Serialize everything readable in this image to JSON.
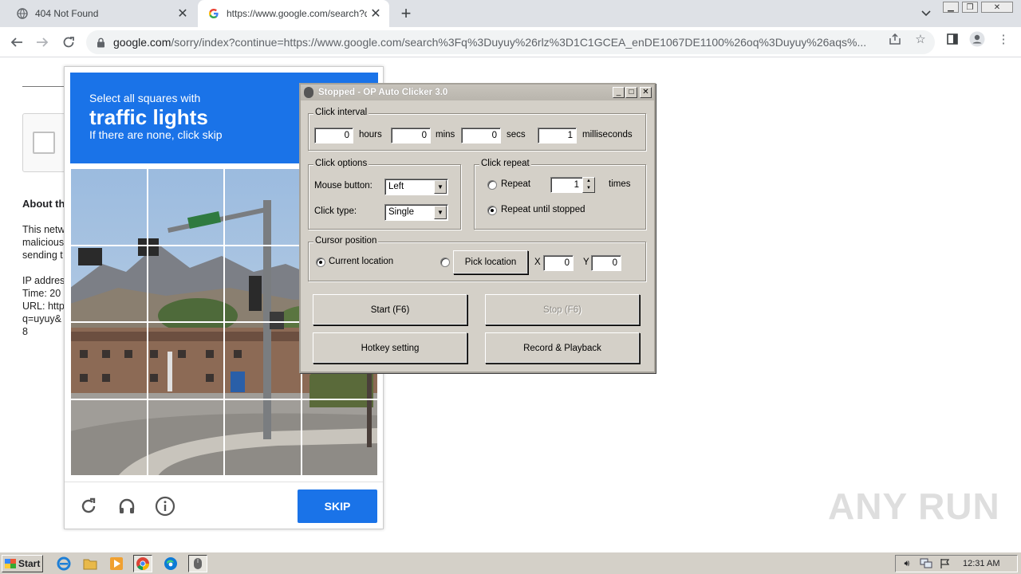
{
  "browser": {
    "tabs": [
      {
        "title": "404 Not Found",
        "favicon": "globe-icon"
      },
      {
        "title": "https://www.google.com/search?q=",
        "favicon": "google-g-icon"
      }
    ],
    "new_tab": "+",
    "url_host": "google.com",
    "url_rest": "/sorry/index?continue=https://www.google.com/search%3Fq%3Duyuy%26rlz%3D1C1GCEA_enDE1067DE1100%26oq%3Duyuy%26aqs%..."
  },
  "page": {
    "about_title": "About th",
    "about_text": "This netw\nmalicious\nsending t\n\nIP addres\nTime: 20\nURL: http\nq=uyuy&\n8"
  },
  "captcha": {
    "instruction": "Select all squares with",
    "target": "traffic lights",
    "hint": "If there are none, click skip",
    "skip_label": "SKIP",
    "colors": {
      "accent": "#1a73e8"
    }
  },
  "clicker": {
    "title": "Stopped - OP Auto Clicker 3.0",
    "interval": {
      "label": "Click interval",
      "hours": "0",
      "hours_label": "hours",
      "mins": "0",
      "mins_label": "mins",
      "secs": "0",
      "secs_label": "secs",
      "ms": "1",
      "ms_label": "milliseconds"
    },
    "options": {
      "label": "Click options",
      "mouse_button_label": "Mouse button:",
      "mouse_button": "Left",
      "click_type_label": "Click type:",
      "click_type": "Single"
    },
    "repeat": {
      "label": "Click repeat",
      "repeat_label": "Repeat",
      "repeat_count": "1",
      "times_label": "times",
      "until_stopped_label": "Repeat until stopped",
      "selected": "until_stopped"
    },
    "cursor": {
      "label": "Cursor position",
      "current_label": "Current location",
      "pick_label": "Pick location",
      "x_label": "X",
      "x": "0",
      "y_label": "Y",
      "y": "0",
      "selected": "current"
    },
    "buttons": {
      "start": "Start (F6)",
      "stop": "Stop (F6)",
      "hotkey": "Hotkey setting",
      "record": "Record & Playback"
    }
  },
  "watermark": "ANY RUN",
  "taskbar": {
    "start_label": "Start",
    "clock": "12:31 AM"
  }
}
